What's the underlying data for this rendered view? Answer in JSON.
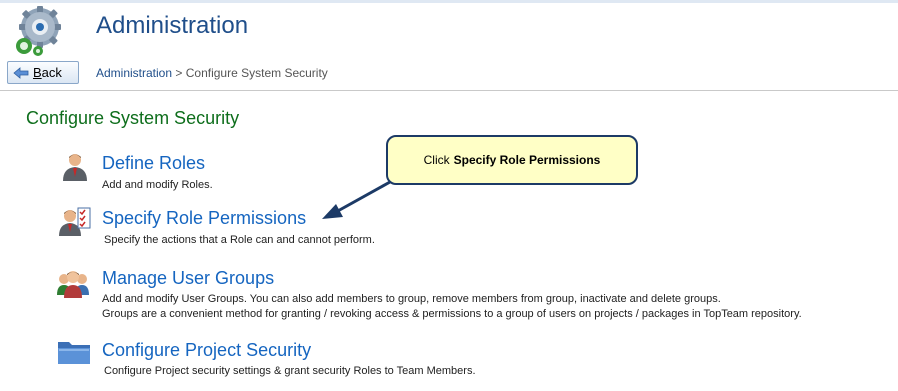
{
  "header": {
    "title": "Administration",
    "icon": "gears-icon",
    "back_label": "Back",
    "back_icon": "back-arrow-icon"
  },
  "breadcrumb": {
    "root": "Administration",
    "separator": ">",
    "current": "Configure System Security"
  },
  "section": {
    "title": "Configure System Security"
  },
  "items": [
    {
      "title": "Define Roles",
      "icon": "user-role-icon",
      "desc1": "Add and modify Roles.",
      "desc2": ""
    },
    {
      "title": "Specify Role Permissions",
      "icon": "role-permissions-icon",
      "desc1": "Specify the actions that a Role can and cannot perform.",
      "desc2": ""
    },
    {
      "title": "Manage User Groups",
      "icon": "user-groups-icon",
      "desc1": "Add and modify User Groups. You can also add members to group, remove members from group, inactivate and delete groups.",
      "desc2": "Groups are a convenient method for granting / revoking access & permissions to a group of users on projects / packages in TopTeam repository."
    },
    {
      "title": "Configure Project Security",
      "icon": "folder-icon",
      "desc1": "Configure Project security settings & grant security Roles to Team Members.",
      "desc2": ""
    }
  ],
  "callout": {
    "prefix": "Click",
    "emphasis": "Specify Role Permissions"
  },
  "colors": {
    "title_blue": "#1f4e8a",
    "link_blue": "#1565c0",
    "section_green": "#0e6e1c",
    "callout_bg": "#ffffc6",
    "callout_border": "#1c3a66"
  }
}
